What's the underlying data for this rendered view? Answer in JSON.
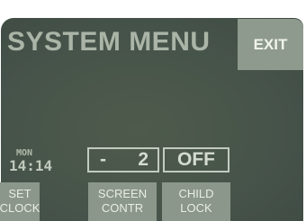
{
  "panel": {
    "title": "SYSTEM MENU",
    "exit_label": "EXIT"
  },
  "clock": {
    "day": "MON",
    "time": "14:14"
  },
  "contrast": {
    "sign": "-",
    "value": "2"
  },
  "child_lock": {
    "state": "OFF"
  },
  "buttons": [
    {
      "line1": "SET",
      "line2": "CLOCK"
    },
    {
      "line1": "SCREEN",
      "line2": "CONTR"
    },
    {
      "line1": "CHILD",
      "line2": "LOCK"
    }
  ],
  "colors": {
    "lcd_background": "#46534a",
    "title_text": "#aab5a7",
    "button_background": "#8b978a",
    "value_text": "#d4dbd1"
  }
}
